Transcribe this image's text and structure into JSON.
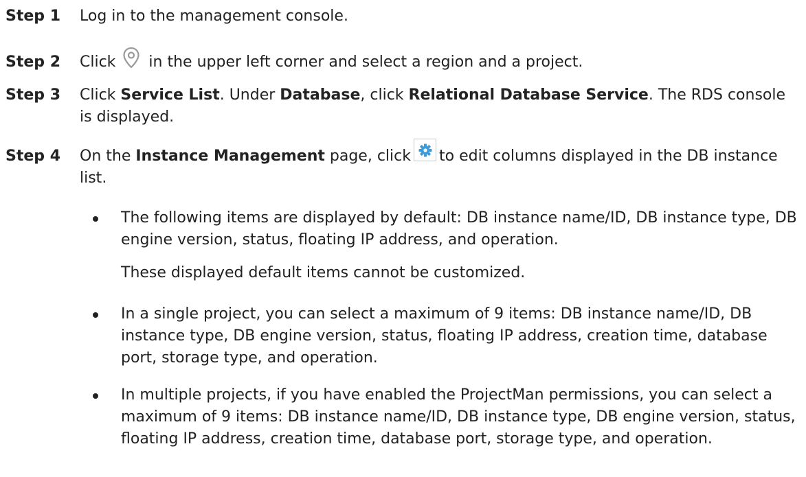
{
  "steps": [
    {
      "label": "Step 1",
      "text": "Log in to the management console."
    },
    {
      "label": "Step 2",
      "pre": "Click",
      "post": "in the upper left corner and select a region and a project."
    },
    {
      "label": "Step 3",
      "t1": "Click ",
      "b1": "Service List",
      "t2": ". Under ",
      "b2": "Database",
      "t3": ", click ",
      "b3": "Relational Database Service",
      "t4": ". The RDS console is displayed."
    },
    {
      "label": "Step 4",
      "t1": "On the ",
      "b1": "Instance Management",
      "t2": " page, click",
      "t3": "to edit columns displayed in the DB instance list."
    }
  ],
  "bullets": [
    {
      "text": "The following items are displayed by default: DB instance name/ID, DB instance type, DB engine version, status, floating IP address, and operation.",
      "note": "These displayed default items cannot be customized."
    },
    {
      "text": "In a single project, you can select a maximum of 9 items: DB instance name/ID, DB instance type, DB engine version, status, floating IP address, creation time, database port, storage type, and operation."
    },
    {
      "text": "In multiple projects, if you have enabled the ProjectMan permissions, you can select a maximum of 9 items: DB instance name/ID, DB instance type, DB engine version, status, floating IP address, creation time, database port, storage type, and operation."
    }
  ],
  "icons": {
    "region_icon": "location-pin-icon",
    "settings_icon": "gear-icon",
    "icon_color": "#999999",
    "gear_color": "#3f9bd9"
  }
}
